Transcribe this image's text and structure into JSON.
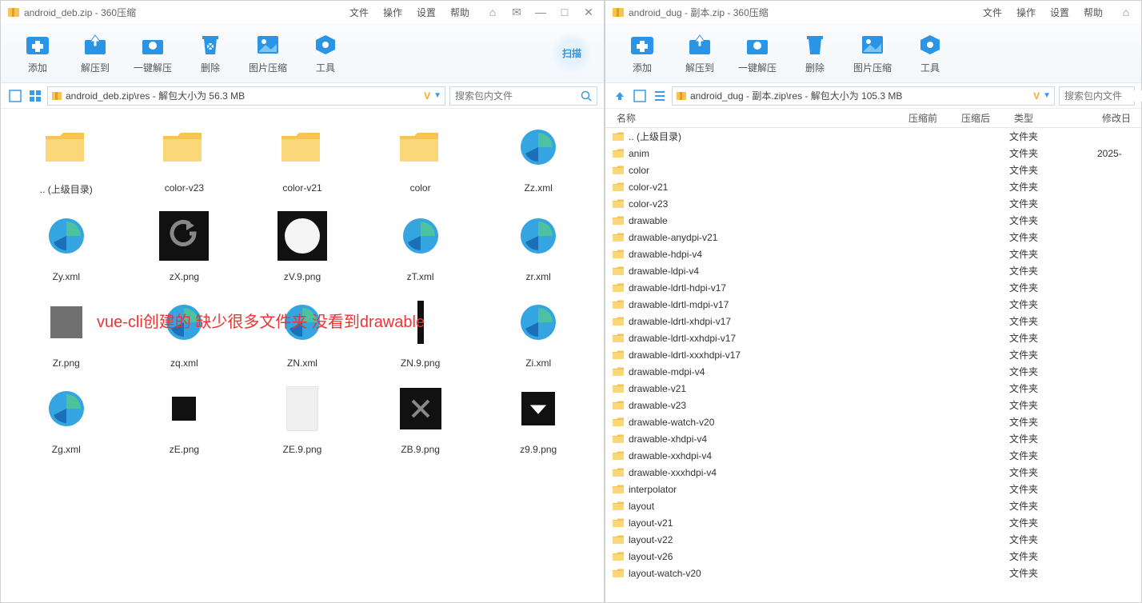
{
  "left": {
    "title": "android_deb.zip - 360压缩",
    "menus": [
      "文件",
      "操作",
      "设置",
      "帮助"
    ],
    "toolbar": [
      "添加",
      "解压到",
      "一键解压",
      "删除",
      "图片压缩",
      "工具"
    ],
    "scan": "扫描",
    "path": "android_deb.zip\\res - 解包大小为 56.3 MB",
    "search_ph": "搜索包内文件",
    "annotation": "vue-cli创建的   缺少很多文件夹 没看到drawable",
    "items": [
      {
        "n": ".. (上级目录)",
        "t": "folder"
      },
      {
        "n": "color-v23",
        "t": "folder"
      },
      {
        "n": "color-v21",
        "t": "folder"
      },
      {
        "n": "color",
        "t": "folder"
      },
      {
        "n": "Zz.xml",
        "t": "edge"
      },
      {
        "n": "Zy.xml",
        "t": "edge"
      },
      {
        "n": "zX.png",
        "t": "img-back"
      },
      {
        "n": "zV.9.png",
        "t": "img-circle"
      },
      {
        "n": "zT.xml",
        "t": "edge"
      },
      {
        "n": "zr.xml",
        "t": "edge"
      },
      {
        "n": "Zr.png",
        "t": "img-gray"
      },
      {
        "n": "zq.xml",
        "t": "edge"
      },
      {
        "n": "ZN.xml",
        "t": "edge"
      },
      {
        "n": "ZN.9.png",
        "t": "img-bar"
      },
      {
        "n": "Zi.xml",
        "t": "edge"
      },
      {
        "n": "Zg.xml",
        "t": "edge"
      },
      {
        "n": "zE.png",
        "t": "img-sq"
      },
      {
        "n": "ZE.9.png",
        "t": "img-blank"
      },
      {
        "n": "ZB.9.png",
        "t": "img-x"
      },
      {
        "n": "z9.9.png",
        "t": "img-tri"
      }
    ]
  },
  "right": {
    "title": "android_dug - 副本.zip - 360压缩",
    "menus": [
      "文件",
      "操作",
      "设置",
      "帮助"
    ],
    "toolbar": [
      "添加",
      "解压到",
      "一键解压",
      "删除",
      "图片压缩",
      "工具"
    ],
    "path": "android_dug - 副本.zip\\res - 解包大小为 105.3 MB",
    "search_ph": "搜索包内文件",
    "columns": {
      "name": "名称",
      "before": "压缩前",
      "after": "压缩后",
      "type": "类型",
      "date": "修改日"
    },
    "folder_type": "文件夹",
    "rows": [
      {
        "n": ".. (上级目录)",
        "d": ""
      },
      {
        "n": "anim",
        "d": "2025-"
      },
      {
        "n": "color",
        "d": ""
      },
      {
        "n": "color-v21",
        "d": ""
      },
      {
        "n": "color-v23",
        "d": ""
      },
      {
        "n": "drawable",
        "d": ""
      },
      {
        "n": "drawable-anydpi-v21",
        "d": ""
      },
      {
        "n": "drawable-hdpi-v4",
        "d": ""
      },
      {
        "n": "drawable-ldpi-v4",
        "d": ""
      },
      {
        "n": "drawable-ldrtl-hdpi-v17",
        "d": ""
      },
      {
        "n": "drawable-ldrtl-mdpi-v17",
        "d": ""
      },
      {
        "n": "drawable-ldrtl-xhdpi-v17",
        "d": ""
      },
      {
        "n": "drawable-ldrtl-xxhdpi-v17",
        "d": ""
      },
      {
        "n": "drawable-ldrtl-xxxhdpi-v17",
        "d": ""
      },
      {
        "n": "drawable-mdpi-v4",
        "d": ""
      },
      {
        "n": "drawable-v21",
        "d": ""
      },
      {
        "n": "drawable-v23",
        "d": ""
      },
      {
        "n": "drawable-watch-v20",
        "d": ""
      },
      {
        "n": "drawable-xhdpi-v4",
        "d": ""
      },
      {
        "n": "drawable-xxhdpi-v4",
        "d": ""
      },
      {
        "n": "drawable-xxxhdpi-v4",
        "d": ""
      },
      {
        "n": "interpolator",
        "d": ""
      },
      {
        "n": "layout",
        "d": ""
      },
      {
        "n": "layout-v21",
        "d": ""
      },
      {
        "n": "layout-v22",
        "d": ""
      },
      {
        "n": "layout-v26",
        "d": ""
      },
      {
        "n": "layout-watch-v20",
        "d": ""
      }
    ]
  }
}
